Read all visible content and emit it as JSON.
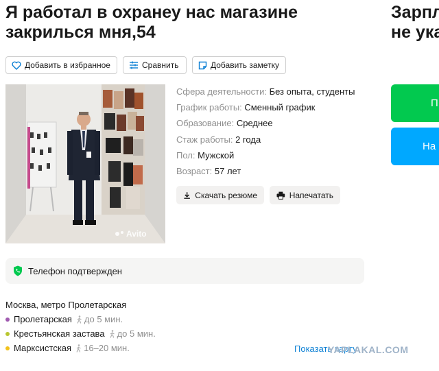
{
  "listing": {
    "title_line1": "Я работал в охранеу нас магазине",
    "title_line2": "закриль­ся мня,54"
  },
  "side": {
    "title_line1": "Зарпл",
    "title_line2": "не ука",
    "green_button_label": "П",
    "blue_button_label": "На"
  },
  "actions": {
    "favorite_label": "Добавить в избранное",
    "compare_label": "Сравнить",
    "note_label": "Добавить заметку"
  },
  "photo": {
    "watermark": "Avito"
  },
  "params": [
    {
      "label": "Сфера деятельности:",
      "value": "Без опыта, студенты"
    },
    {
      "label": "График работы:",
      "value": "Сменный график"
    },
    {
      "label": "Образование:",
      "value": "Среднее"
    },
    {
      "label": "Стаж работы:",
      "value": "2 года"
    },
    {
      "label": "Пол:",
      "value": "Мужской"
    },
    {
      "label": "Возраст:",
      "value": "57 лет"
    }
  ],
  "buttons": {
    "download_label": "Скачать резюме",
    "print_label": "Напечатать"
  },
  "phone": {
    "status_text": "Телефон подтвержден"
  },
  "location": {
    "address": "Москва, метро Пролетарская",
    "metro": [
      {
        "name": "Пролетарская",
        "walk": "до 5 мин.",
        "color": "#a05ab0"
      },
      {
        "name": "Крестьянская застава",
        "walk": "до 5 мин.",
        "color": "#b8c62f"
      },
      {
        "name": "Марксистская",
        "walk": "16–20 мин.",
        "color": "#f2c21a"
      }
    ],
    "map_link": "Показать карту"
  },
  "site_watermark": "YAPLAKAL.COM",
  "colors": {
    "link": "#0a7fd4",
    "green": "#02c94f",
    "blue": "#00a8ff",
    "muted": "#8f8f8f"
  }
}
